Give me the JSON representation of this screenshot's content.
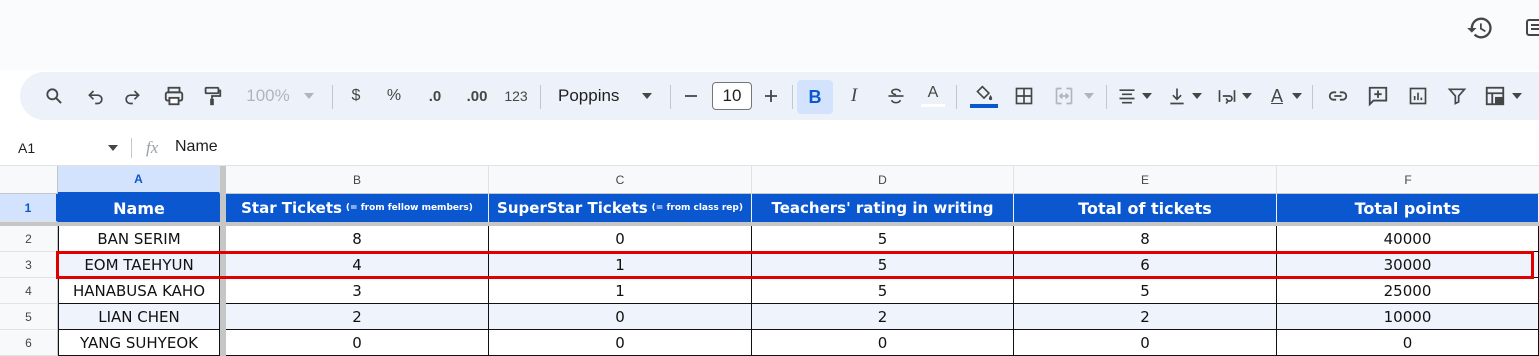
{
  "toolbar": {
    "zoom": "100%",
    "currency": "$",
    "percent": "%",
    "decrease_decimal": ".0",
    "increase_decimal": ".00",
    "number_format": "123",
    "font_name": "Poppins",
    "font_size": "10",
    "bold": "B",
    "italic": "I",
    "text_color": "A",
    "text_rotation": "A"
  },
  "formula_bar": {
    "cell_ref": "A1",
    "fx": "fx",
    "content": "Name"
  },
  "columns": [
    "A",
    "B",
    "C",
    "D",
    "E",
    "F"
  ],
  "rows": [
    "1",
    "2",
    "3",
    "4",
    "5",
    "6"
  ],
  "table": {
    "headers": [
      {
        "text": "Name",
        "note": ""
      },
      {
        "text": "Star Tickets",
        "note": "(= from fellow members)"
      },
      {
        "text": "SuperStar Tickets",
        "note": "(= from class rep)"
      },
      {
        "text": "Teachers' rating in writing",
        "note": ""
      },
      {
        "text": "Total of tickets",
        "note": ""
      },
      {
        "text": "Total points",
        "note": ""
      }
    ],
    "rows": [
      [
        "BAN SERIM",
        "8",
        "0",
        "5",
        "8",
        "40000"
      ],
      [
        "EOM TAEHYUN",
        "4",
        "1",
        "5",
        "6",
        "30000"
      ],
      [
        "HANABUSA KAHO",
        "3",
        "1",
        "5",
        "5",
        "25000"
      ],
      [
        "LIAN CHEN",
        "2",
        "0",
        "2",
        "2",
        "10000"
      ],
      [
        "YANG SUHYEOK",
        "0",
        "0",
        "0",
        "0",
        "0"
      ]
    ]
  },
  "colors": {
    "header_fill": "#0b57d0",
    "alt_row": "#eef3fc",
    "highlight_box": "#e00000",
    "selection": "#d3e3fd"
  }
}
